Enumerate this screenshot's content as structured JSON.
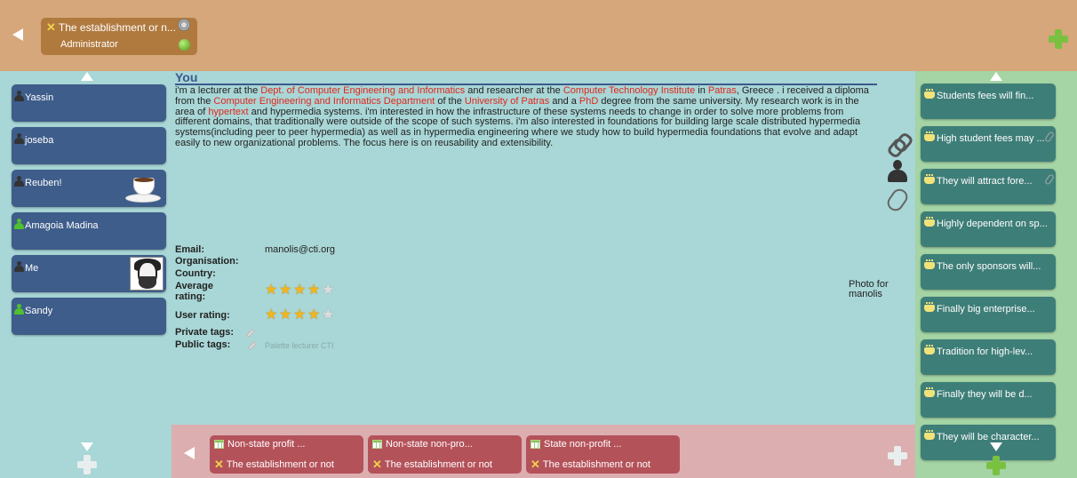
{
  "header": {
    "discussion_title": "The establishment or n...",
    "role": "Administrator"
  },
  "users": [
    {
      "name": "Yassin",
      "status": "offline"
    },
    {
      "name": "joseba",
      "status": "offline"
    },
    {
      "name": "Reuben!",
      "status": "offline"
    },
    {
      "name": "Amagoia Madina",
      "status": "online"
    },
    {
      "name": "Me",
      "status": "offline"
    },
    {
      "name": "Sandy",
      "status": "online"
    }
  ],
  "profile": {
    "title": "You",
    "bio": {
      "p1": "i'm a lecturer at the ",
      "l1": "Dept. of Computer Engineering and Informatics",
      "p2": " and researcher at the ",
      "l2": "Computer Technology Institute",
      "p3": " in ",
      "l3": "Patras",
      "p4": ", Greece . i received a diploma from the ",
      "l4": "Computer Engineering and Informatics Department",
      "p5": " of the ",
      "l5": "University of Patras",
      "p6": " and a ",
      "l6": "PhD",
      "p7": " degree from the same university. My research work is in the area of ",
      "l7": "hypertext",
      "p8": " and hypermedia systems. i'm interested in how the infrastructure of these systems needs to change in order to solve more problems from different domains, that traditionally were outside of the scope of such systems. i'm also interested in foundations for building large scale distributed hypermedia systems(including peer to peer hypermedia) as well as in hypermedia engineering where we study how to build hypermedia foundations that evolve and adapt easily to new organizational problems. The focus here is on reusability and extensibility."
    },
    "email_label": "Email:",
    "email": "manolis@cti.org",
    "organisation_label": "Organisation:",
    "country_label": "Country:",
    "avg_rating_label": "Average rating:",
    "avg_rating": 4,
    "user_rating_label": "User rating:",
    "user_rating": 4,
    "rating_max": 5,
    "private_tags_label": "Private tags:",
    "public_tags_label": "Public tags:",
    "public_tags": "Palette lecturer CTI",
    "photo_caption": "Photo for manolis"
  },
  "ideas": [
    {
      "title": "Non-state profit ...",
      "discussion": "The establishment or not"
    },
    {
      "title": "Non-state non-pro...",
      "discussion": "The establishment or not"
    },
    {
      "title": "State non-profit ...",
      "discussion": "The establishment or not"
    }
  ],
  "arguments": [
    {
      "text": "Students fees will fin...",
      "attached": false
    },
    {
      "text": "High student fees may ...",
      "attached": true
    },
    {
      "text": "They will attract fore...",
      "attached": true
    },
    {
      "text": "Highly dependent on sp...",
      "attached": false
    },
    {
      "text": "The only sponsors will...",
      "attached": false
    },
    {
      "text": "Finally big enterprise...",
      "attached": false
    },
    {
      "text": "Tradition for high-lev...",
      "attached": false
    },
    {
      "text": "Finally they will be d...",
      "attached": false
    },
    {
      "text": "They will be character...",
      "attached": false
    }
  ],
  "colors": {
    "header": "#d6a77a",
    "user_card": "#3e5d8a",
    "argument_card": "#3e7e78",
    "idea_card": "#b4525a",
    "link": "#e0271d"
  }
}
